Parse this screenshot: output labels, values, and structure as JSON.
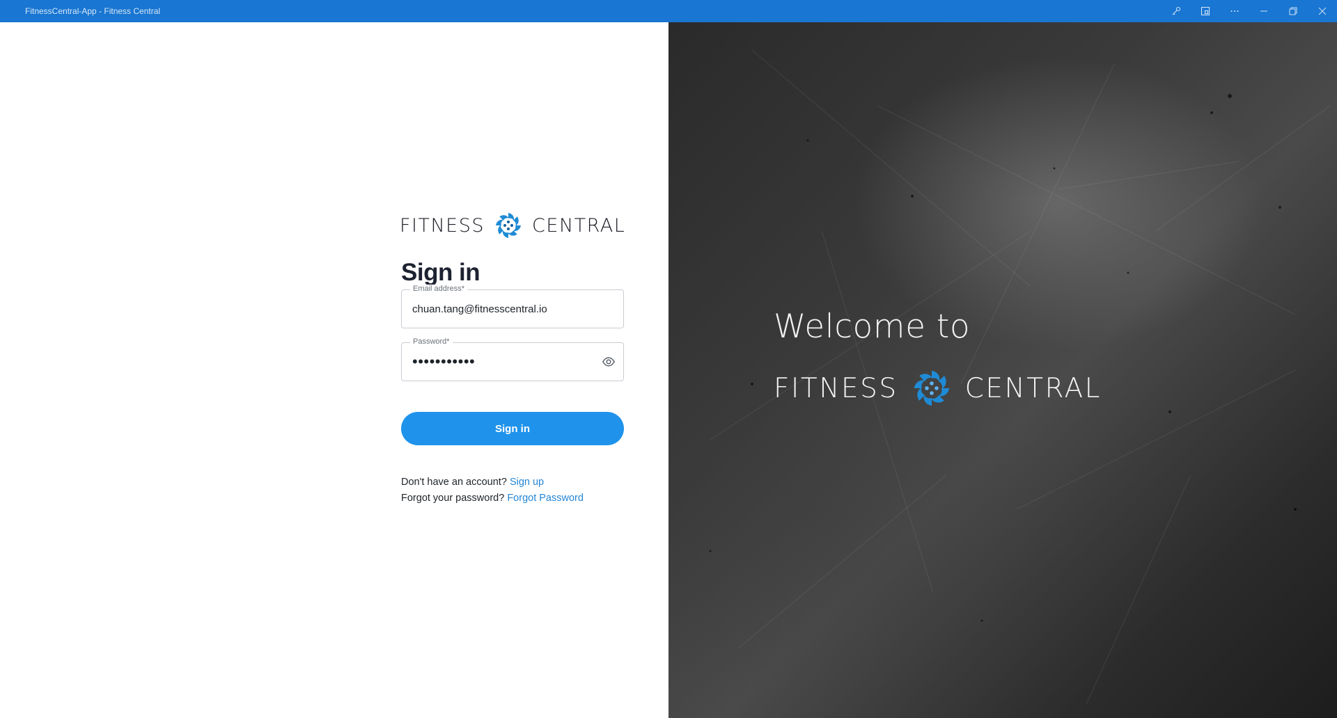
{
  "window": {
    "title": "FitnessCentral-App - Fitness Central",
    "controls": [
      "key-icon",
      "cast-icon",
      "more-icon",
      "minimize-icon",
      "restore-icon",
      "close-icon"
    ]
  },
  "brand": {
    "word_left": "FITNESS",
    "word_right": "CENTRAL",
    "accent": "#1f8bd6"
  },
  "form": {
    "title": "Sign in",
    "email": {
      "label": "Email address*",
      "value": "chuan.tang@fitnesscentral.io"
    },
    "password": {
      "label": "Password*",
      "masked_value": "•••••••••••"
    },
    "submit_label": "Sign in",
    "signup_prompt": "Don't have an account?",
    "signup_link": "Sign up",
    "forgot_prompt": "Forgot your password?",
    "forgot_link": "Forgot Password"
  },
  "hero": {
    "welcome": "Welcome to"
  },
  "colors": {
    "titlebar": "#1976d2",
    "primary_button": "#1f93eb",
    "link": "#2386d6"
  }
}
